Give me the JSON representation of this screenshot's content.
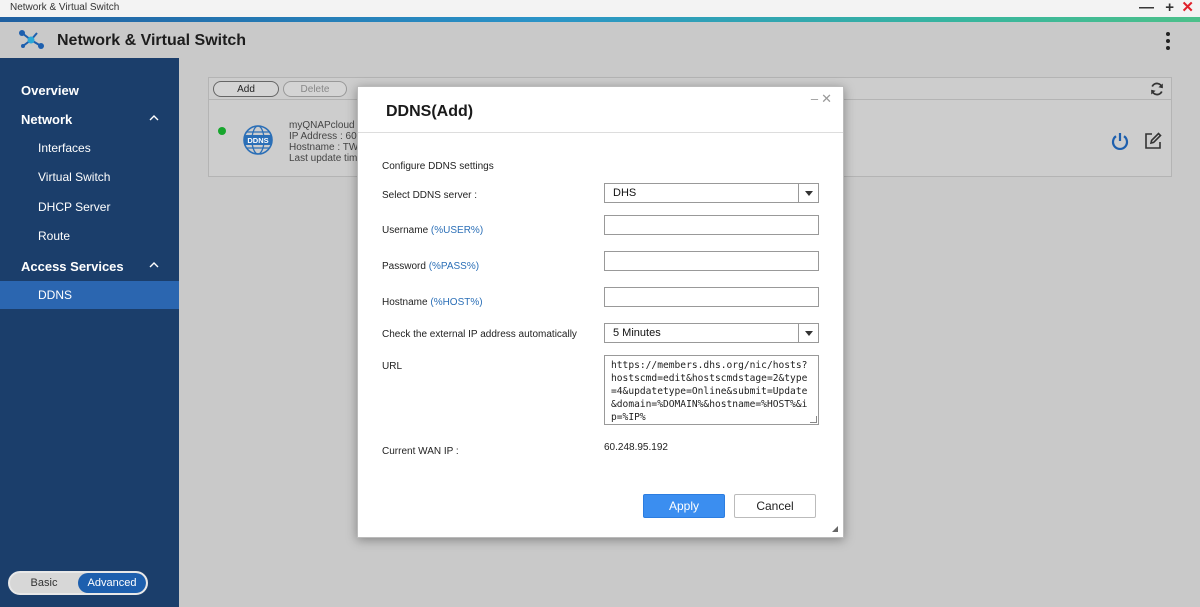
{
  "window": {
    "title": "Network & Virtual Switch",
    "controls": [
      "—",
      "+",
      "✕"
    ]
  },
  "app": {
    "title": "Network & Virtual Switch"
  },
  "sidebar": {
    "items": [
      {
        "label": "Overview"
      },
      {
        "label": "Network"
      },
      {
        "label": "Interfaces"
      },
      {
        "label": "Virtual Switch"
      },
      {
        "label": "DHCP Server"
      },
      {
        "label": "Route"
      },
      {
        "label": "Access Services"
      },
      {
        "label": "DDNS"
      }
    ],
    "mode": {
      "basic": "Basic",
      "advanced": "Advanced"
    }
  },
  "toolbar": {
    "add_label": "Add",
    "delete_label": "Delete"
  },
  "ddns_entry": {
    "service": "myQNAPcloud",
    "ip_line": "IP Address : 60.",
    "hostname_line": "Hostname : TW",
    "update_line": "Last update tim",
    "icon_text": "DDNS"
  },
  "modal": {
    "title": "DDNS(Add)",
    "controls": "–✕",
    "section": "Configure DDNS settings",
    "server_label": "Select DDNS server :",
    "server_value": "DHS",
    "username_label": "Username",
    "username_var": "(%USER%)",
    "username_value": "",
    "password_label": "Password",
    "password_var": "(%PASS%)",
    "password_value": "",
    "hostname_label": "Hostname",
    "hostname_var": "(%HOST%)",
    "hostname_value": "",
    "check_label": "Check the external IP address automatically",
    "check_value": "5 Minutes",
    "url_label": "URL",
    "url_value": "https://members.dhs.org/nic/hosts?hostscmd=edit&hostscmdstage=2&type=4&updatetype=Online&submit=Update&domain=%DOMAIN%&hostname=%HOST%&ip=%IP%",
    "wan_label": "Current WAN IP :",
    "wan_value": "60.248.95.192",
    "apply_label": "Apply",
    "cancel_label": "Cancel"
  },
  "colors": {
    "sidebar_bg": "#1b3e6b",
    "sidebar_active": "#2b66b0",
    "apply_bg": "#3b8ef0",
    "status_ok": "#17a62d",
    "close_red": "#e0202a"
  }
}
